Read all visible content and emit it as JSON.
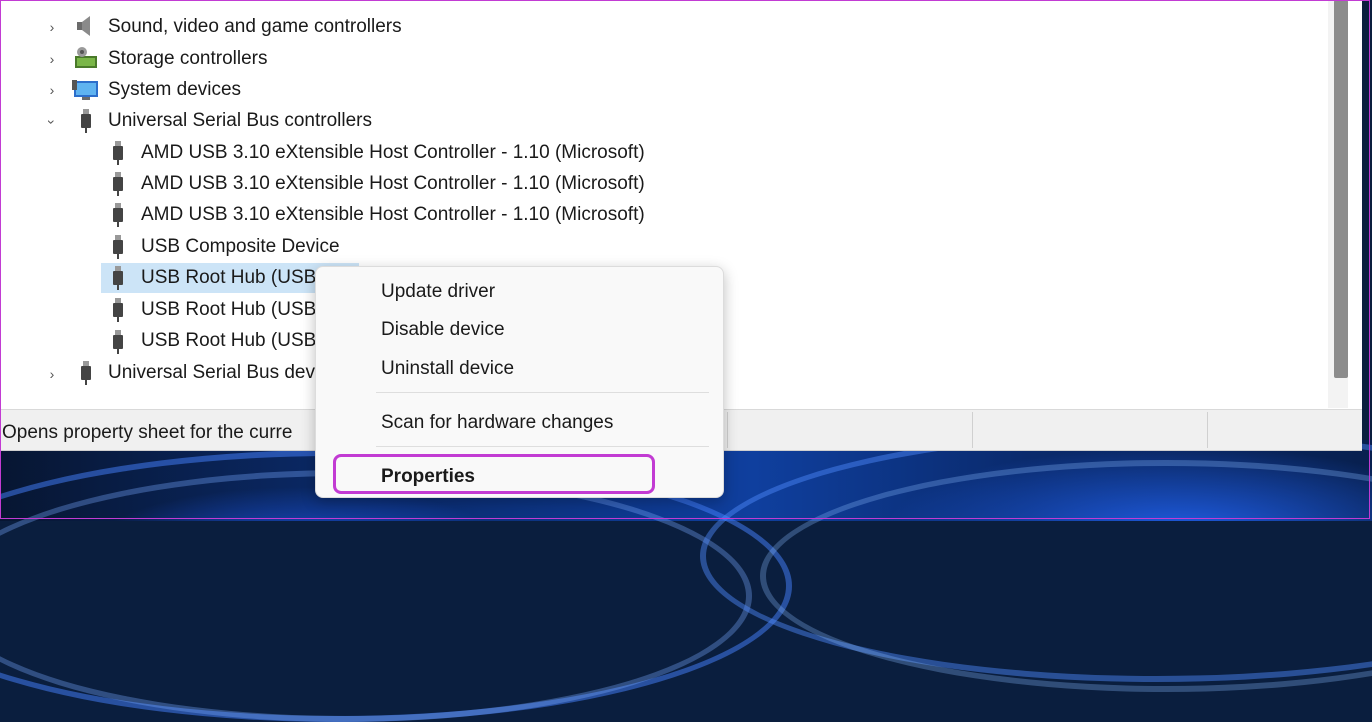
{
  "tree": {
    "categories": [
      {
        "label": "Sound, video and game controllers",
        "expanded": false,
        "icon": "speaker-icon"
      },
      {
        "label": "Storage controllers",
        "expanded": false,
        "icon": "storage-icon"
      },
      {
        "label": "System devices",
        "expanded": false,
        "icon": "monitor-icon"
      },
      {
        "label": "Universal Serial Bus controllers",
        "expanded": true,
        "icon": "usb-plug-icon"
      }
    ],
    "usb_children": [
      "AMD USB 3.10 eXtensible Host Controller - 1.10 (Microsoft)",
      "AMD USB 3.10 eXtensible Host Controller - 1.10 (Microsoft)",
      "AMD USB 3.10 eXtensible Host Controller - 1.10 (Microsoft)",
      "USB Composite Device",
      "USB Root Hub (USB",
      "USB Root Hub (USB",
      "USB Root Hub (USB"
    ],
    "last_category": "Universal Serial Bus dev"
  },
  "status_bar": {
    "text": "Opens property sheet for the curre"
  },
  "context_menu": {
    "update_driver": "Update driver",
    "disable_device": "Disable device",
    "uninstall_device": "Uninstall device",
    "scan_hardware": "Scan for hardware changes",
    "properties": "Properties"
  },
  "colors": {
    "highlight": "#c23bd3",
    "selection": "#cce4f7"
  }
}
